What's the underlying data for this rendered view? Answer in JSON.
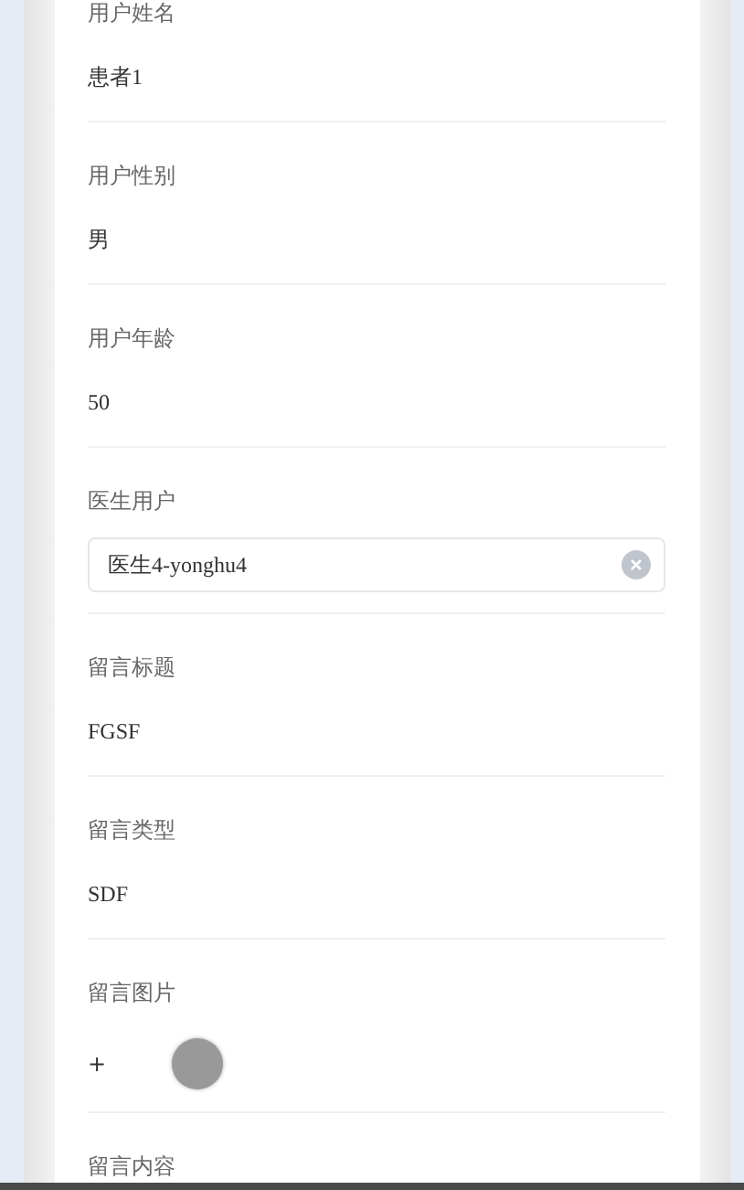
{
  "fields": [
    {
      "kind": "text",
      "label": "用户姓名",
      "value": "患者1"
    },
    {
      "kind": "text",
      "label": "用户性别",
      "value": "男"
    },
    {
      "kind": "text",
      "label": "用户年龄",
      "value": "50"
    },
    {
      "kind": "select",
      "label": "医生用户",
      "value": "医生4-yonghu4"
    },
    {
      "kind": "text",
      "label": "留言标题",
      "value": "FGSF"
    },
    {
      "kind": "text",
      "label": "留言类型",
      "value": "SDF"
    },
    {
      "kind": "image",
      "label": "留言图片",
      "value": "+"
    },
    {
      "kind": "text",
      "label": "留言内容"
    }
  ]
}
